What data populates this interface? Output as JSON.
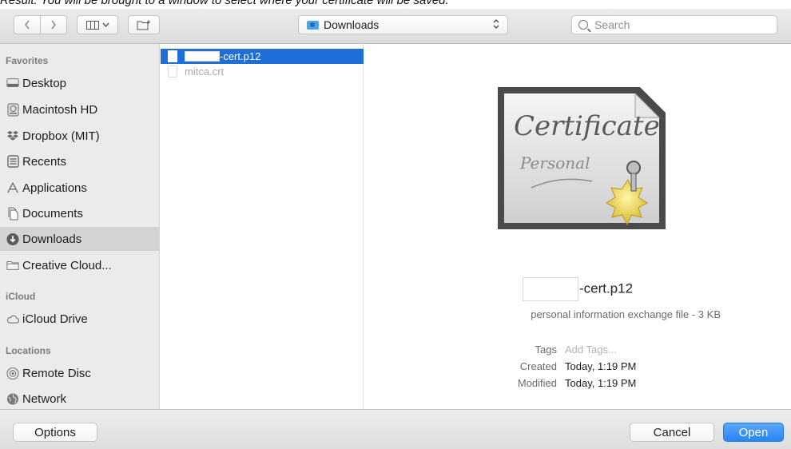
{
  "caption": "Result: You will be brought to a window to select where your certificate will be saved.",
  "toolbar": {
    "back_icon": "chevron-left",
    "forward_icon": "chevron-right",
    "view_icon": "column-view",
    "view_chevron": "⌄",
    "new_folder_icon": "new-folder",
    "location_label": "Downloads",
    "search_placeholder": "Search"
  },
  "sidebar": {
    "sections": [
      {
        "title": "Favorites",
        "items": [
          {
            "label": "Desktop",
            "icon": "desktop-icon"
          },
          {
            "label": "Macintosh HD",
            "icon": "hard-drive-icon"
          },
          {
            "label": "Dropbox (MIT)",
            "icon": "dropbox-icon"
          },
          {
            "label": "Recents",
            "icon": "recents-icon"
          },
          {
            "label": "Applications",
            "icon": "applications-icon"
          },
          {
            "label": "Documents",
            "icon": "documents-icon"
          },
          {
            "label": "Downloads",
            "icon": "downloads-icon",
            "selected": true
          },
          {
            "label": "Creative Cloud...",
            "icon": "folder-icon"
          }
        ]
      },
      {
        "title": "iCloud",
        "items": [
          {
            "label": "iCloud Drive",
            "icon": "cloud-icon"
          }
        ]
      },
      {
        "title": "Locations",
        "items": [
          {
            "label": "Remote Disc",
            "icon": "disc-icon"
          },
          {
            "label": "Network",
            "icon": "network-icon"
          }
        ]
      }
    ]
  },
  "files": [
    {
      "name": "-cert.p12",
      "selected": true,
      "redacted_prefix": true
    },
    {
      "name": "mitca.crt",
      "selected": false,
      "dim": true
    }
  ],
  "preview": {
    "icon_text_1": "Certificate",
    "icon_text_2": "Personal",
    "file_name": "-cert.p12",
    "kind": "personal information exchange file - 3 KB",
    "meta": [
      {
        "key": "Tags",
        "value": "Add Tags...",
        "placeholder": true
      },
      {
        "key": "Created",
        "value": "Today, 1:19 PM"
      },
      {
        "key": "Modified",
        "value": "Today, 1:19 PM"
      }
    ]
  },
  "buttons": {
    "options": "Options",
    "cancel": "Cancel",
    "open": "Open"
  },
  "colors": {
    "selection_blue": "#1e6fd9",
    "primary_button": "#2a84f3",
    "sidebar_bg": "#ebebeb"
  }
}
